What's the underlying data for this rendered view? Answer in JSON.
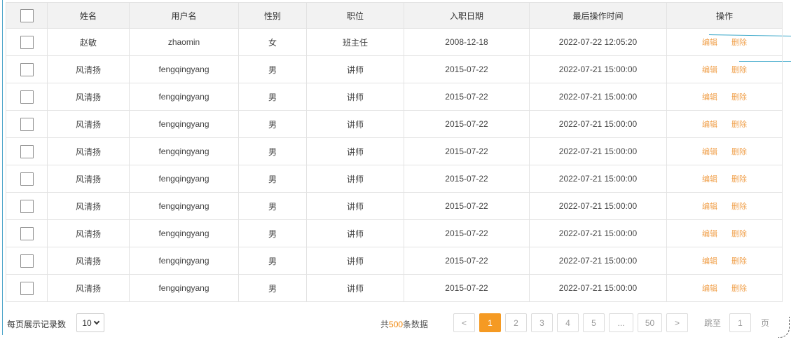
{
  "table": {
    "headers": {
      "name": "姓名",
      "username": "用户名",
      "gender": "性别",
      "position": "职位",
      "hire_date": "入职日期",
      "last_op_time": "最后操作时间",
      "actions": "操作"
    },
    "rows": [
      {
        "name": "赵敏",
        "username": "zhaomin",
        "gender": "女",
        "position": "班主任",
        "hire_date": "2008-12-18",
        "last_op_time": "2022-07-22 12:05:20",
        "edit": "编辑",
        "delete": "删除"
      },
      {
        "name": "风清扬",
        "username": "fengqingyang",
        "gender": "男",
        "position": "讲师",
        "hire_date": "2015-07-22",
        "last_op_time": "2022-07-21 15:00:00",
        "edit": "编辑",
        "delete": "删除"
      },
      {
        "name": "风清扬",
        "username": "fengqingyang",
        "gender": "男",
        "position": "讲师",
        "hire_date": "2015-07-22",
        "last_op_time": "2022-07-21 15:00:00",
        "edit": "编辑",
        "delete": "删除"
      },
      {
        "name": "风清扬",
        "username": "fengqingyang",
        "gender": "男",
        "position": "讲师",
        "hire_date": "2015-07-22",
        "last_op_time": "2022-07-21 15:00:00",
        "edit": "编辑",
        "delete": "删除"
      },
      {
        "name": "风清扬",
        "username": "fengqingyang",
        "gender": "男",
        "position": "讲师",
        "hire_date": "2015-07-22",
        "last_op_time": "2022-07-21 15:00:00",
        "edit": "编辑",
        "delete": "删除"
      },
      {
        "name": "风清扬",
        "username": "fengqingyang",
        "gender": "男",
        "position": "讲师",
        "hire_date": "2015-07-22",
        "last_op_time": "2022-07-21 15:00:00",
        "edit": "编辑",
        "delete": "删除"
      },
      {
        "name": "风清扬",
        "username": "fengqingyang",
        "gender": "男",
        "position": "讲师",
        "hire_date": "2015-07-22",
        "last_op_time": "2022-07-21 15:00:00",
        "edit": "编辑",
        "delete": "删除"
      },
      {
        "name": "风清扬",
        "username": "fengqingyang",
        "gender": "男",
        "position": "讲师",
        "hire_date": "2015-07-22",
        "last_op_time": "2022-07-21 15:00:00",
        "edit": "编辑",
        "delete": "删除"
      },
      {
        "name": "风清扬",
        "username": "fengqingyang",
        "gender": "男",
        "position": "讲师",
        "hire_date": "2015-07-22",
        "last_op_time": "2022-07-21 15:00:00",
        "edit": "编辑",
        "delete": "删除"
      },
      {
        "name": "风清扬",
        "username": "fengqingyang",
        "gender": "男",
        "position": "讲师",
        "hire_date": "2015-07-22",
        "last_op_time": "2022-07-21 15:00:00",
        "edit": "编辑",
        "delete": "删除"
      }
    ]
  },
  "footer": {
    "per_page_label": "每页展示记录数",
    "per_page_value": "10",
    "total_prefix": "共",
    "total_count": "500",
    "total_suffix": "条数据",
    "pager": {
      "prev": "<",
      "pages": [
        "1",
        "2",
        "3",
        "4",
        "5",
        "...",
        "50"
      ],
      "current": "1",
      "next": ">"
    },
    "jump_label": "跳至",
    "jump_value": "1",
    "jump_suffix": "页"
  },
  "colors": {
    "accent": "#f59a23",
    "action_text": "#f0a04b",
    "header_bg": "#f2f2f2",
    "border": "#e3e3e3"
  },
  "icons": {
    "checkbox": "checkbox-icon",
    "select_arrow": "chevron-down-icon"
  }
}
